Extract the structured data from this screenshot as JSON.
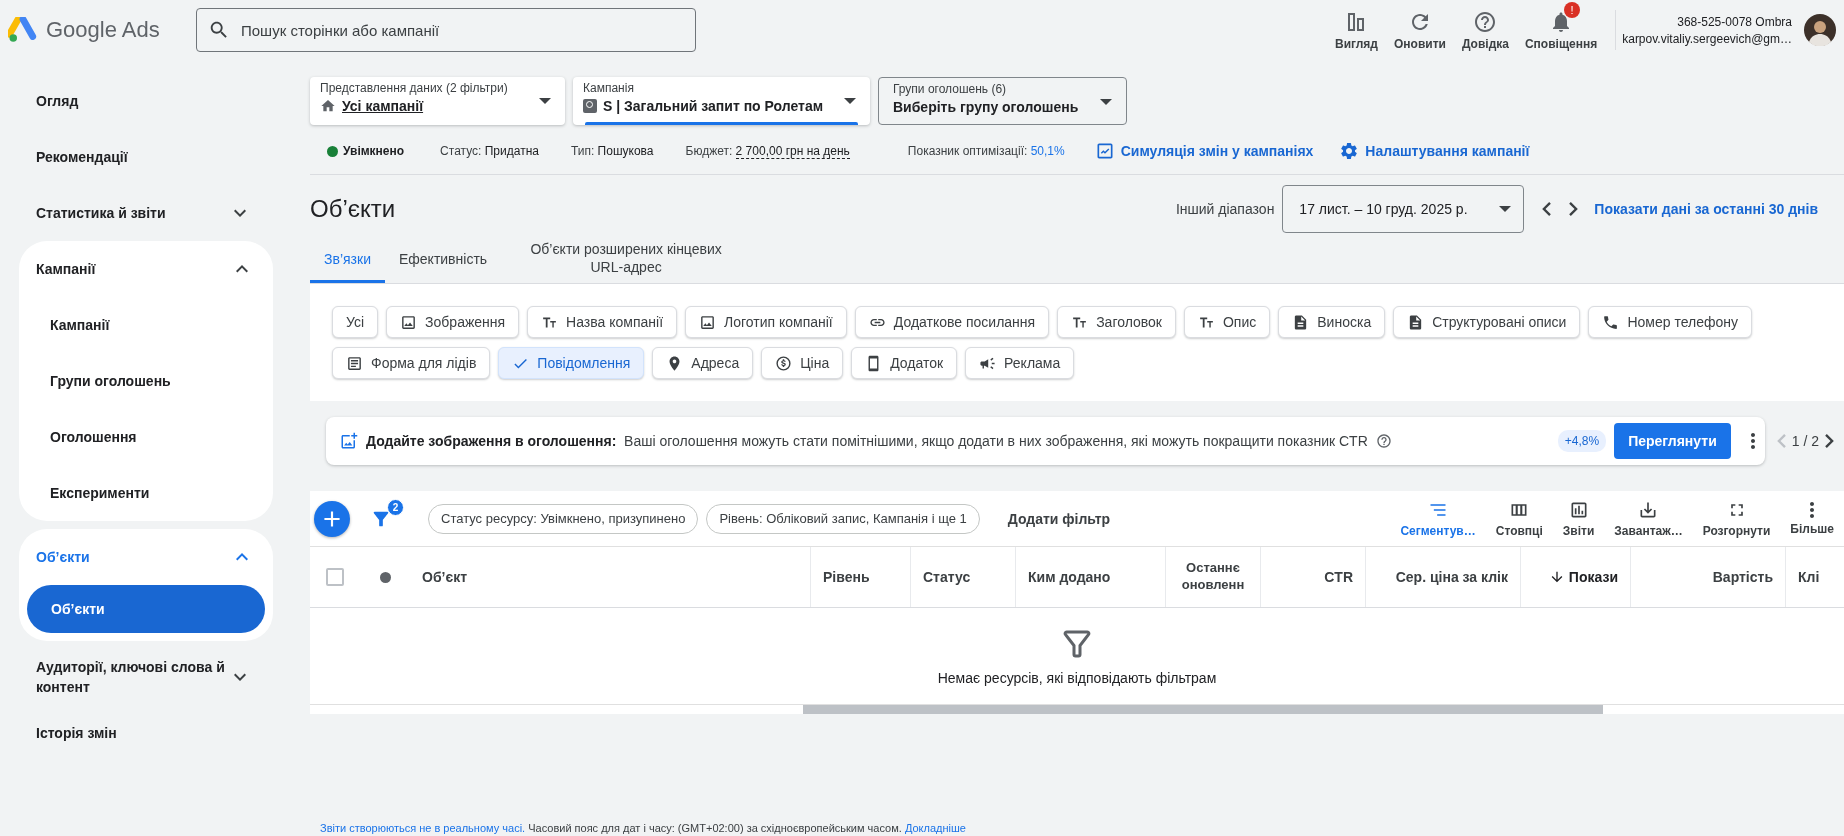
{
  "header": {
    "product": "Google Ads",
    "search": {
      "placeholder": "Пошук сторінки або кампанії"
    },
    "actions": [
      {
        "kind": "view",
        "label": "Вигляд"
      },
      {
        "kind": "refresh",
        "label": "Оновити"
      },
      {
        "kind": "help",
        "label": "Довідка"
      },
      {
        "kind": "notifications",
        "label": "Сповіщення",
        "badge": "!"
      }
    ],
    "account": {
      "id": "368-525-0078 Ombra",
      "email": "karpov.vitaliy.sergeevich@gm…"
    }
  },
  "sidebar": {
    "items": [
      {
        "label": "Огляд",
        "selected": false
      },
      {
        "label": "Рекомендації",
        "selected": false
      },
      {
        "label": "Статистика й звіти",
        "selected": false,
        "expanded": false
      },
      {
        "label": "Кампанії",
        "selected": false,
        "expanded": true,
        "children": [
          {
            "label": "Кампанії",
            "selected": false
          },
          {
            "label": "Групи оголошень",
            "selected": false
          },
          {
            "label": "Оголошення",
            "selected": false
          },
          {
            "label": "Експерименти",
            "selected": false
          }
        ]
      },
      {
        "label": "Об’єкти",
        "selected": true,
        "expanded": true,
        "children": [
          {
            "label": "Об’єкти",
            "selected": true
          }
        ]
      },
      {
        "label": "Аудиторії, ключові слова й контент",
        "selected": false,
        "expanded": false
      },
      {
        "label": "Історія змін",
        "selected": false
      }
    ]
  },
  "pickers": [
    {
      "kind": "view",
      "label": "Представлення даних (2 фільтри)",
      "value": "Усі кампанії",
      "selected": false
    },
    {
      "kind": "campaign",
      "label": "Кампанія",
      "value": "S | Загальний запит по Ролетам",
      "selected": true
    },
    {
      "kind": "plain",
      "label": "Групи оголошень (6)",
      "value": "Виберіть групу оголошень",
      "selected": false
    }
  ],
  "campaign_info": {
    "status": {
      "label": "Увімкнено",
      "on": true
    },
    "facts": [
      {
        "kind": "plain",
        "label": "Статус:",
        "value": "Придатна"
      },
      {
        "kind": "plain",
        "label": "Тип:",
        "value": "Пошукова"
      },
      {
        "kind": "underlined",
        "label": "Бюджет:",
        "value": "2 700,00 грн на день"
      },
      {
        "kind": "score",
        "label": "Показник оптимізації:",
        "value": "50,1%"
      }
    ],
    "links": [
      {
        "kind": "simulation",
        "label": "Симуляція змін у кампаніях"
      },
      {
        "kind": "settings",
        "label": "Налаштування кампанії"
      }
    ]
  },
  "page": {
    "title": "Об’єкти",
    "range_label": "Інший діапазон",
    "range": "17 лист. – 10 груд. 2025 р.",
    "range_link": "Показати дані за останні 30 днів"
  },
  "tabs": [
    {
      "label": "Зв’язки",
      "selected": true
    },
    {
      "label": "Ефективність",
      "selected": false
    },
    {
      "label": "Об’єкти розширених кінцевих URL-адрес",
      "selected": false
    }
  ],
  "chips": [
    {
      "kind": "none",
      "label": "Усі",
      "selected": false
    },
    {
      "kind": "image",
      "label": "Зображення",
      "selected": false
    },
    {
      "kind": "text",
      "label": "Назва компанії",
      "selected": false
    },
    {
      "kind": "image",
      "label": "Логотип компанії",
      "selected": false
    },
    {
      "kind": "link",
      "label": "Додаткове посилання",
      "selected": false
    },
    {
      "kind": "text",
      "label": "Заголовок",
      "selected": false
    },
    {
      "kind": "text",
      "label": "Опис",
      "selected": false
    },
    {
      "kind": "doc",
      "label": "Виноска",
      "selected": false
    },
    {
      "kind": "doc",
      "label": "Структуровані описи",
      "selected": false
    },
    {
      "kind": "phone",
      "label": "Номер телефону",
      "selected": false
    },
    {
      "kind": "form",
      "label": "Форма для лідів",
      "selected": false
    },
    {
      "label": "Повідомлення",
      "selected": true
    },
    {
      "kind": "pin",
      "label": "Адреса",
      "selected": false
    },
    {
      "kind": "coin",
      "label": "Ціна",
      "selected": false
    },
    {
      "kind": "mobile",
      "label": "Додаток",
      "selected": false
    },
    {
      "kind": "megaphone",
      "label": "Реклама",
      "selected": false
    }
  ],
  "banner": {
    "title": "Додайте зображення в оголошення:",
    "text": "Ваші оголошення можуть стати помітнішими, якщо додати в них зображення, які можуть покращити показник CTR",
    "uplift": "+4,8%",
    "action": "Переглянути",
    "pager": "1 / 2"
  },
  "toolbar": {
    "filter_count": "2",
    "filters": [
      "Статус ресурсу: Увімкнено, призупинено",
      "Рівень: Обліковий запис, Кампанія і ще 1"
    ],
    "add_filter": "Додати фільтр",
    "tools": [
      {
        "kind": "segment",
        "label": "Сегментув…",
        "selected": true
      },
      {
        "kind": "columns",
        "label": "Стовпці",
        "selected": false
      },
      {
        "kind": "reports",
        "label": "Звіти",
        "selected": false
      },
      {
        "kind": "download",
        "label": "Завантаж…",
        "selected": false
      },
      {
        "kind": "expand",
        "label": "Розгорнути",
        "selected": false
      },
      {
        "kind": "more",
        "label": "Більше",
        "selected": false
      }
    ]
  },
  "table": {
    "select_all": {
      "checked": false
    },
    "columns": [
      {
        "kind": "text",
        "label": "Об’єкт",
        "sorted": false
      },
      {
        "kind": "text",
        "label": "Рівень",
        "sorted": false
      },
      {
        "kind": "text",
        "label": "Статус",
        "sorted": false
      },
      {
        "kind": "text",
        "label": "Ким додано",
        "sorted": false
      },
      {
        "kind": "center",
        "label": "Останнє оновленн",
        "sorted": false
      },
      {
        "kind": "metric",
        "label": "CTR",
        "sorted": false
      },
      {
        "kind": "metric",
        "label": "Сер. ціна за клік",
        "sorted": false
      },
      {
        "kind": "metric",
        "label": "Покази",
        "sorted": true
      },
      {
        "kind": "metric",
        "label": "Вартість",
        "sorted": false
      },
      {
        "kind": "text",
        "label": "Клі",
        "sorted": false
      }
    ],
    "empty": "Немає ресурсів, які відповідають фільтрам"
  },
  "footer": {
    "note": "Звіти створюються не в реальному часі.",
    "text": "Часовий пояс для дат і часу: (GMT+02:00) за східноєвропейським часом.",
    "link": "Докладніше"
  }
}
